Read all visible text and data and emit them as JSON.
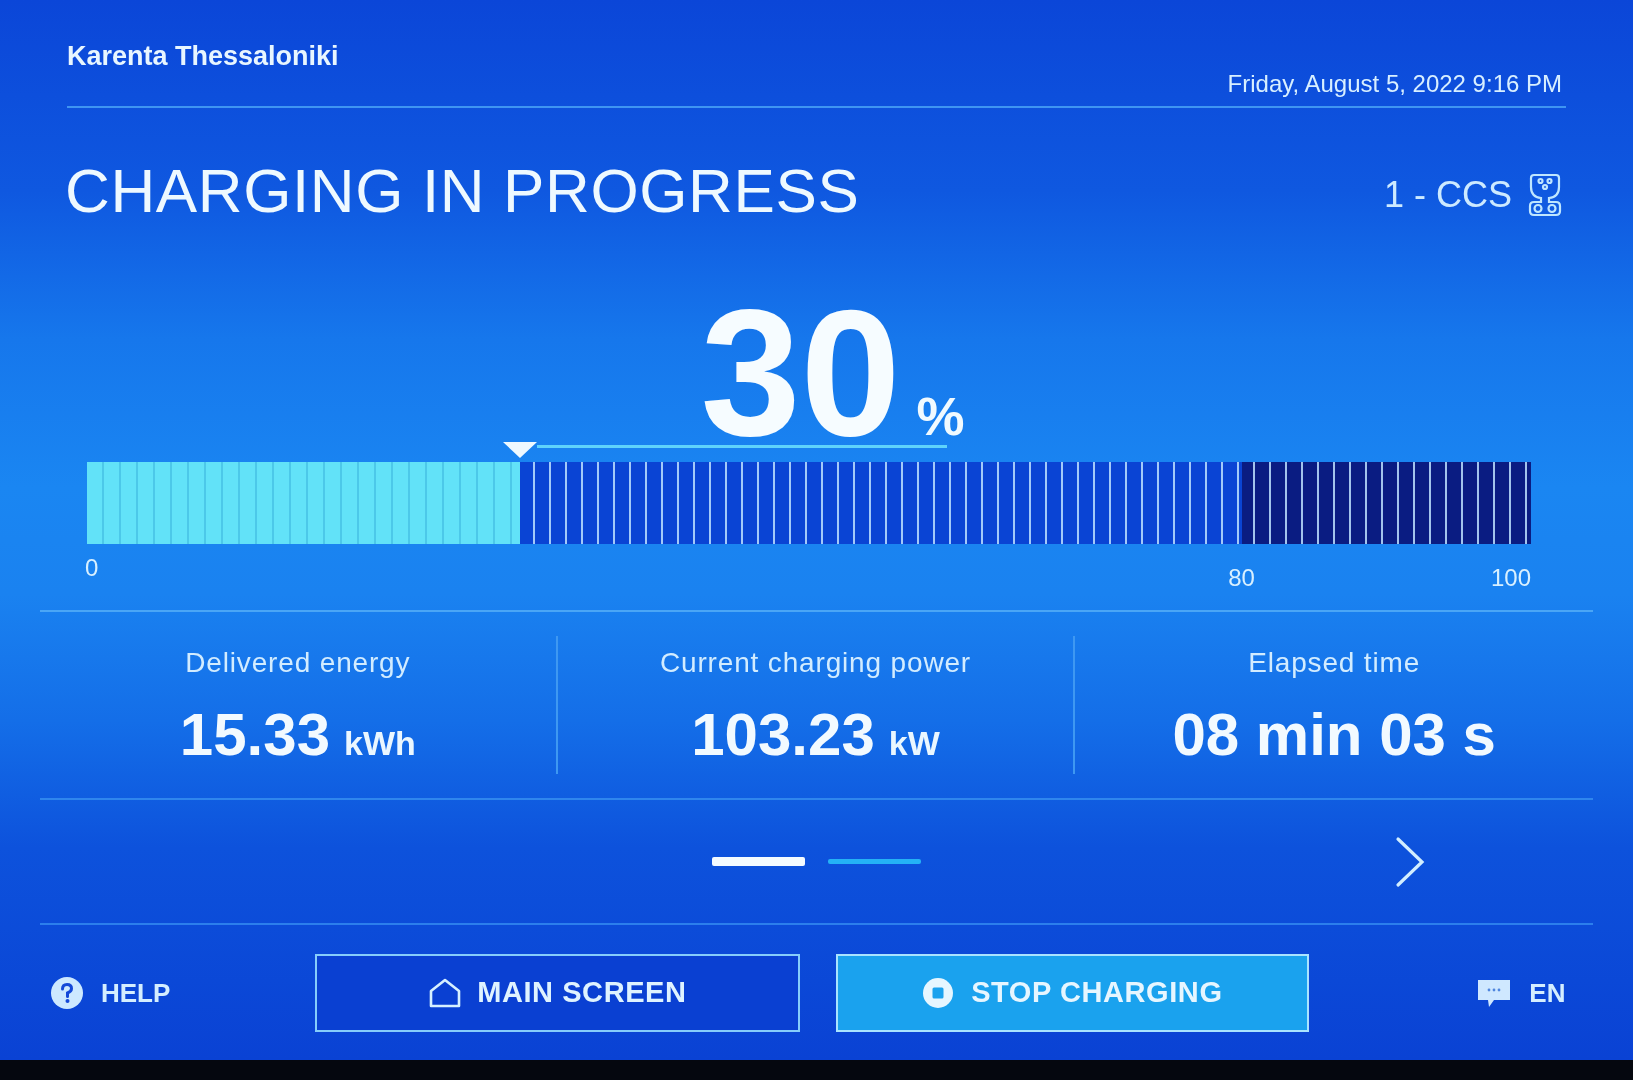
{
  "header": {
    "site_name": "Karenta Thessaloniki",
    "datetime": "Friday, August 5, 2022 9:16 PM"
  },
  "title": "CHARGING IN PROGRESS",
  "connector": {
    "label": "1 - CCS"
  },
  "state_of_charge": {
    "value": "30",
    "unit": "%",
    "level": 0.3,
    "scale_labels": [
      "0",
      "80",
      "100"
    ]
  },
  "stats": [
    {
      "label": "Delivered energy",
      "value": "15.33",
      "unit": "kWh"
    },
    {
      "label": "Current charging power",
      "value": "103.23",
      "unit": "kW"
    },
    {
      "label": "Elapsed time",
      "value": "08 min 03 s"
    }
  ],
  "pager": [
    {
      "selected": true
    },
    {
      "selected": false
    }
  ],
  "footer": {
    "help": {
      "label": "HELP"
    },
    "buttons": [
      {
        "kind": "outline",
        "label": "MAIN SCREEN"
      },
      {
        "kind": "filled",
        "label": "STOP CHARGING"
      }
    ],
    "language": {
      "label": "EN"
    }
  }
}
